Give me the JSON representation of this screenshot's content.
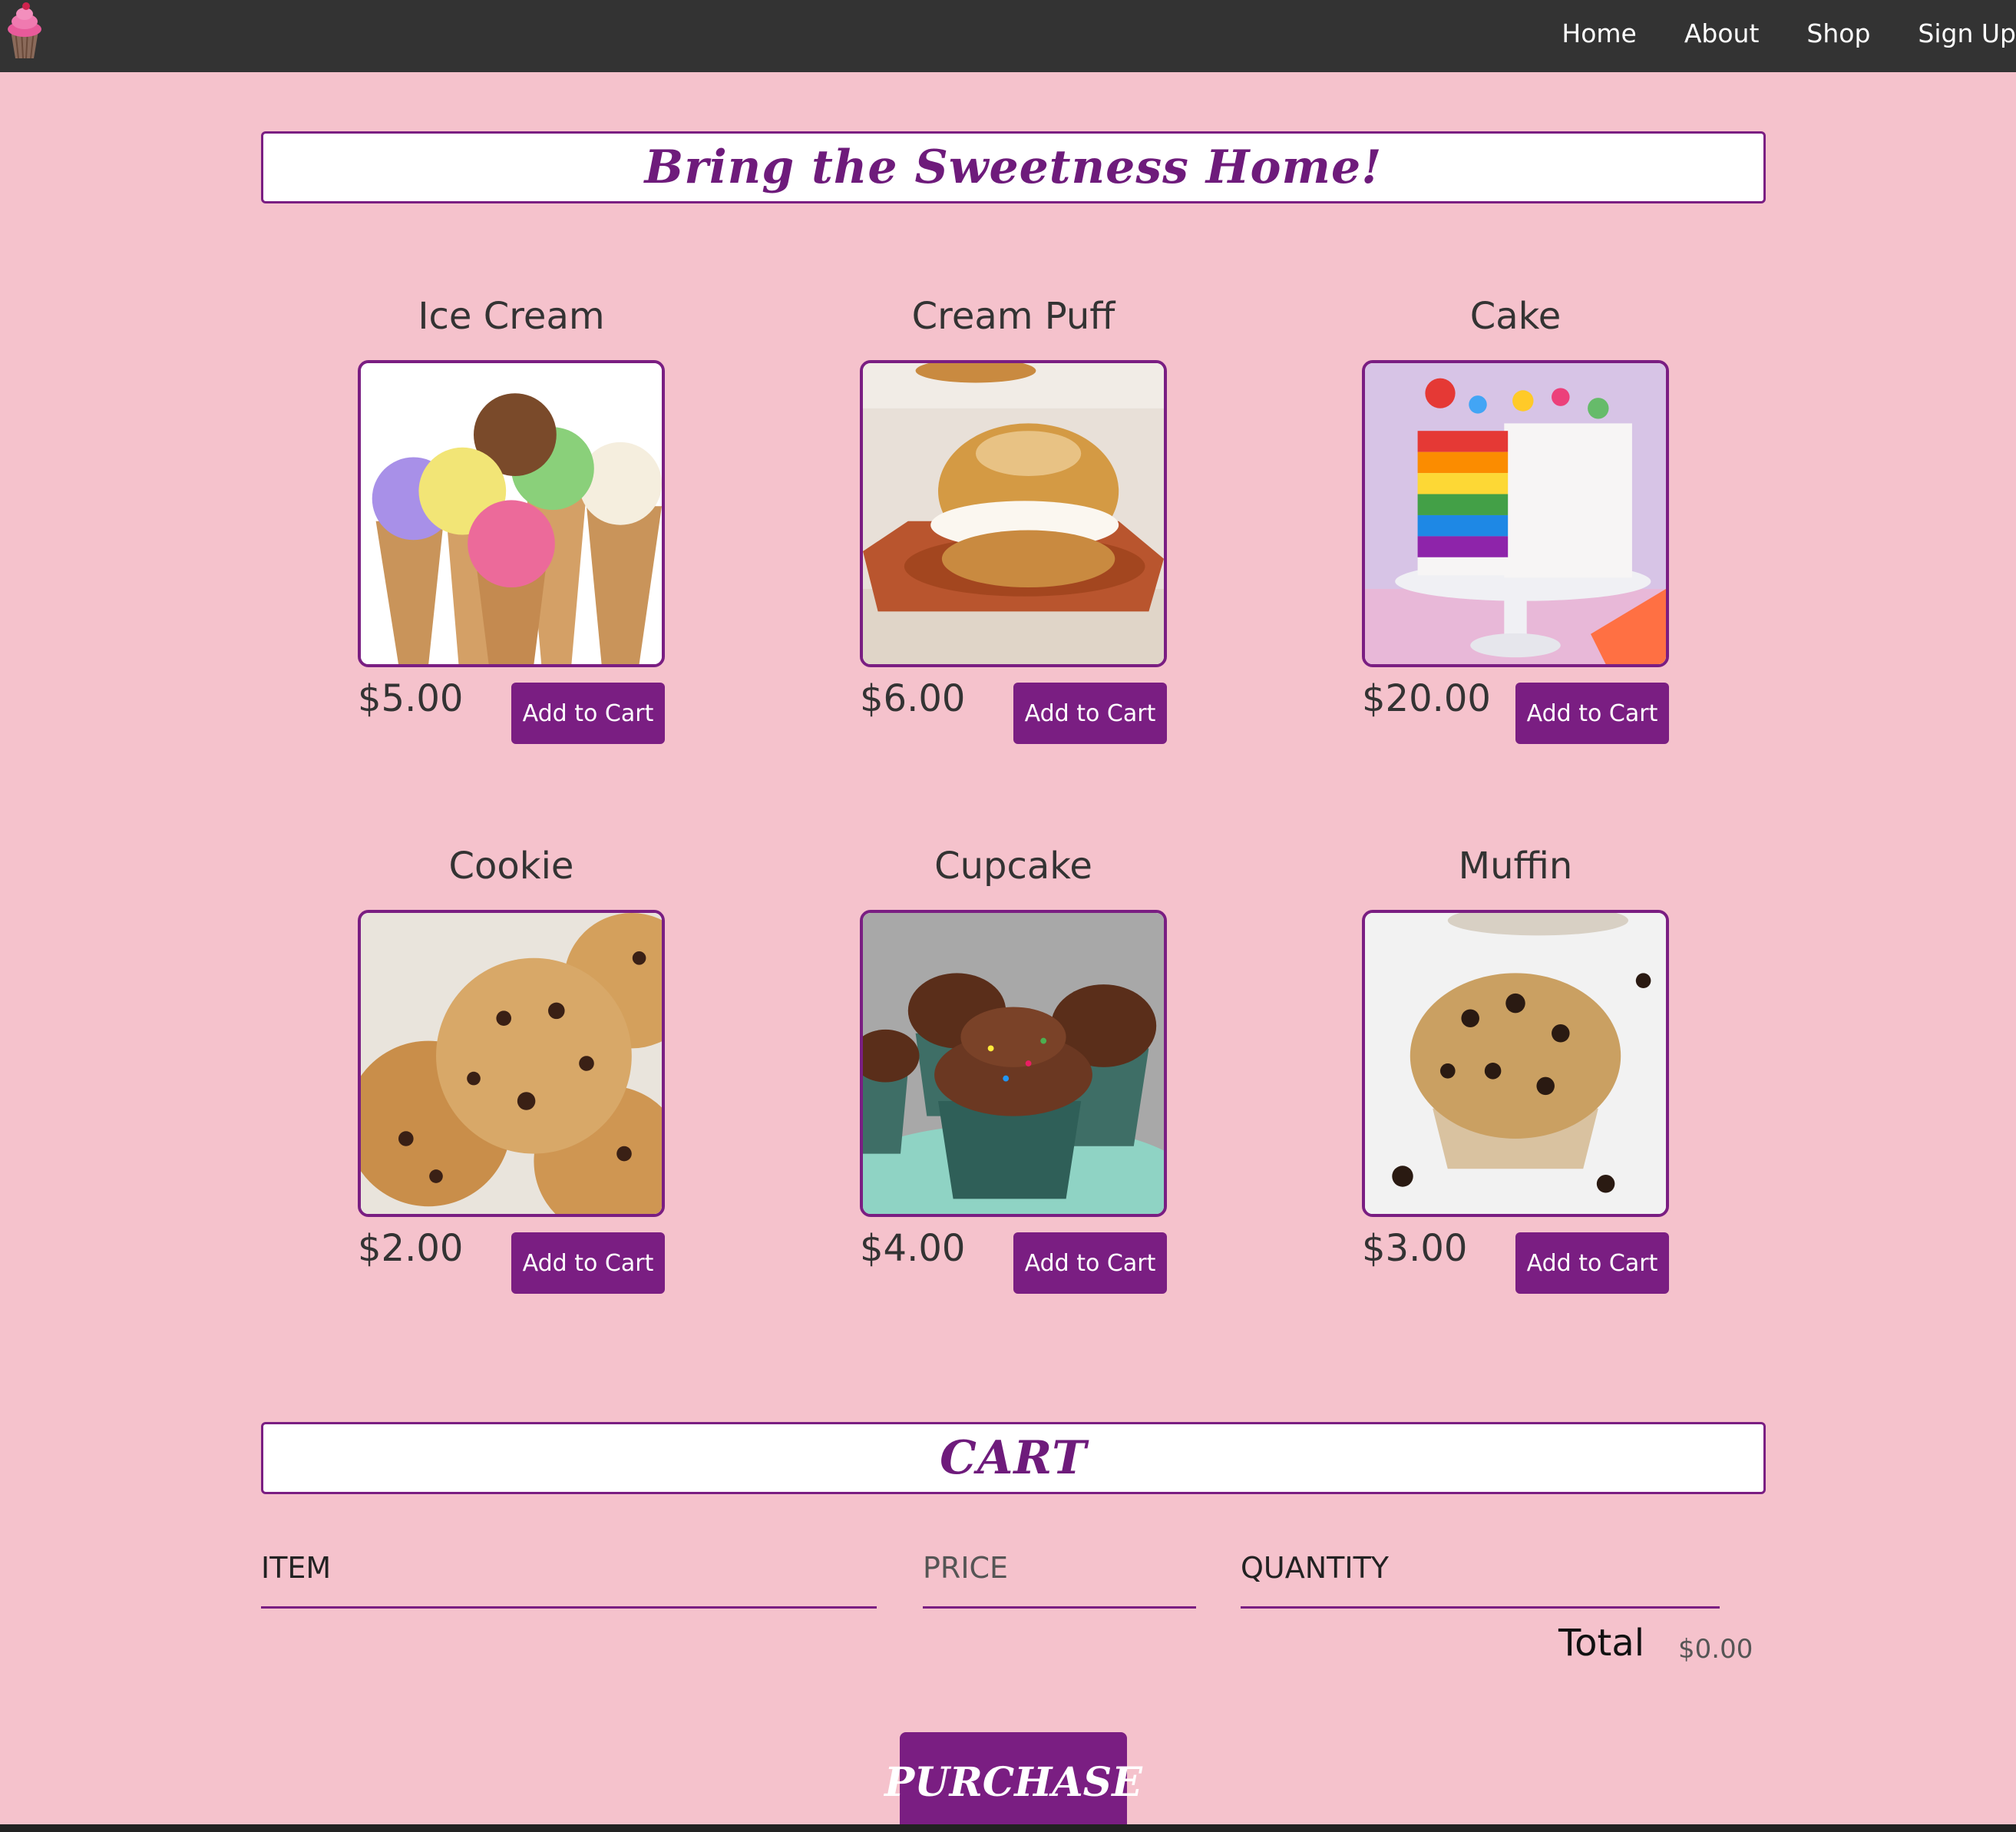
{
  "nav": {
    "logo_icon": "cupcake-icon",
    "links": [
      "Home",
      "About",
      "Shop",
      "Sign Up"
    ]
  },
  "shop": {
    "heading": "Bring the Sweetness Home!"
  },
  "products": [
    {
      "name": "Ice Cream",
      "price": "$5.00",
      "button": "Add to Cart",
      "image_icon": "ice-cream-icon"
    },
    {
      "name": "Cream Puff",
      "price": "$6.00",
      "button": "Add to Cart",
      "image_icon": "cream-puff-icon"
    },
    {
      "name": "Cake",
      "price": "$20.00",
      "button": "Add to Cart",
      "image_icon": "cake-icon"
    },
    {
      "name": "Cookie",
      "price": "$2.00",
      "button": "Add to Cart",
      "image_icon": "cookie-icon"
    },
    {
      "name": "Cupcake",
      "price": "$4.00",
      "button": "Add to Cart",
      "image_icon": "cupcake-icon"
    },
    {
      "name": "Muffin",
      "price": "$3.00",
      "button": "Add to Cart",
      "image_icon": "muffin-icon"
    }
  ],
  "cart": {
    "heading": "CART",
    "columns": [
      "ITEM",
      "PRICE",
      "QUANTITY"
    ],
    "total_label": "Total",
    "total_value": "$0.00",
    "purchase_label": "PURCHASE"
  },
  "colors": {
    "background": "#f5c2cc",
    "accent": "#7a1e82",
    "navbar": "#333333"
  }
}
